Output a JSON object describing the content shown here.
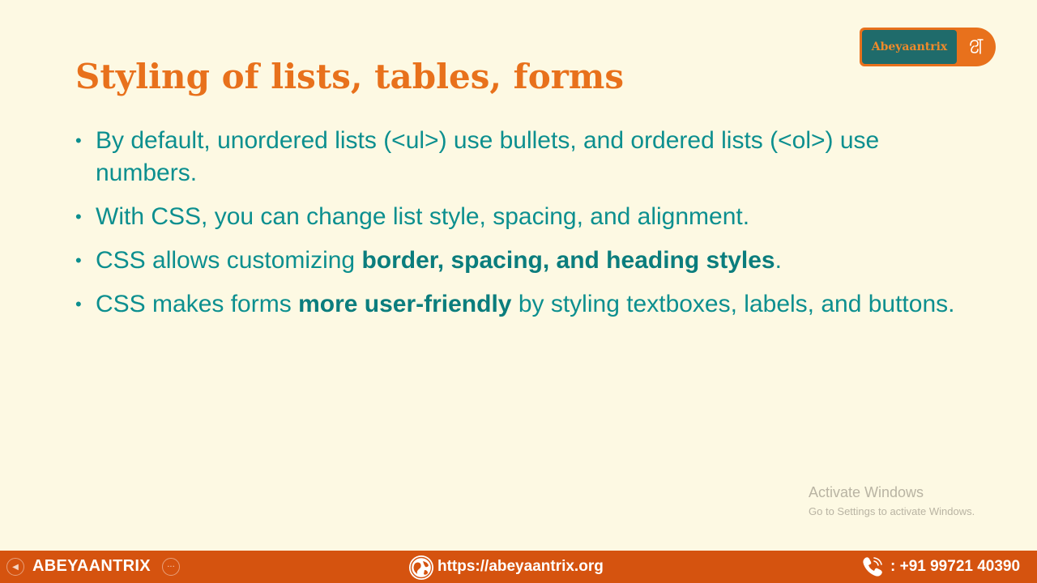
{
  "slide": {
    "title": "Styling of lists, tables, forms",
    "bullets": [
      {
        "parts": [
          {
            "text": "By default, unordered lists (<ul>) use bullets, and ordered lists (<ol>) use numbers.",
            "bold": false
          }
        ]
      },
      {
        "parts": [
          {
            "text": "With CSS, you can change list style, spacing, and alignment.",
            "bold": false
          }
        ]
      },
      {
        "parts": [
          {
            "text": "CSS allows customizing ",
            "bold": false
          },
          {
            "text": "border, spacing, and heading styles",
            "bold": true
          },
          {
            "text": ".",
            "bold": false
          }
        ]
      },
      {
        "parts": [
          {
            "text": "CSS makes forms ",
            "bold": false
          },
          {
            "text": "more user-friendly",
            "bold": true
          },
          {
            "text": " by styling textboxes, labels, and buttons.",
            "bold": false
          }
        ]
      }
    ],
    "bullet_glyph": "•"
  },
  "badge": {
    "text": "Abeyaantrix",
    "symbol_icon": "brand-symbol-icon"
  },
  "watermark": {
    "line1": "Activate Windows",
    "line2": "Go to Settings to activate Windows."
  },
  "footer": {
    "brand": "ABEYAANTRIX",
    "url": "https://abeyaantrix.org",
    "phone": ": +91 99721 40390",
    "nav_prev_glyph": "◀",
    "nav_more_glyph": "···"
  },
  "colors": {
    "title": "#e8711c",
    "body_text": "#0c8f8f",
    "background": "#fdf9e3",
    "footer": "#d5530f",
    "badge_teal": "#1f6b6b"
  }
}
